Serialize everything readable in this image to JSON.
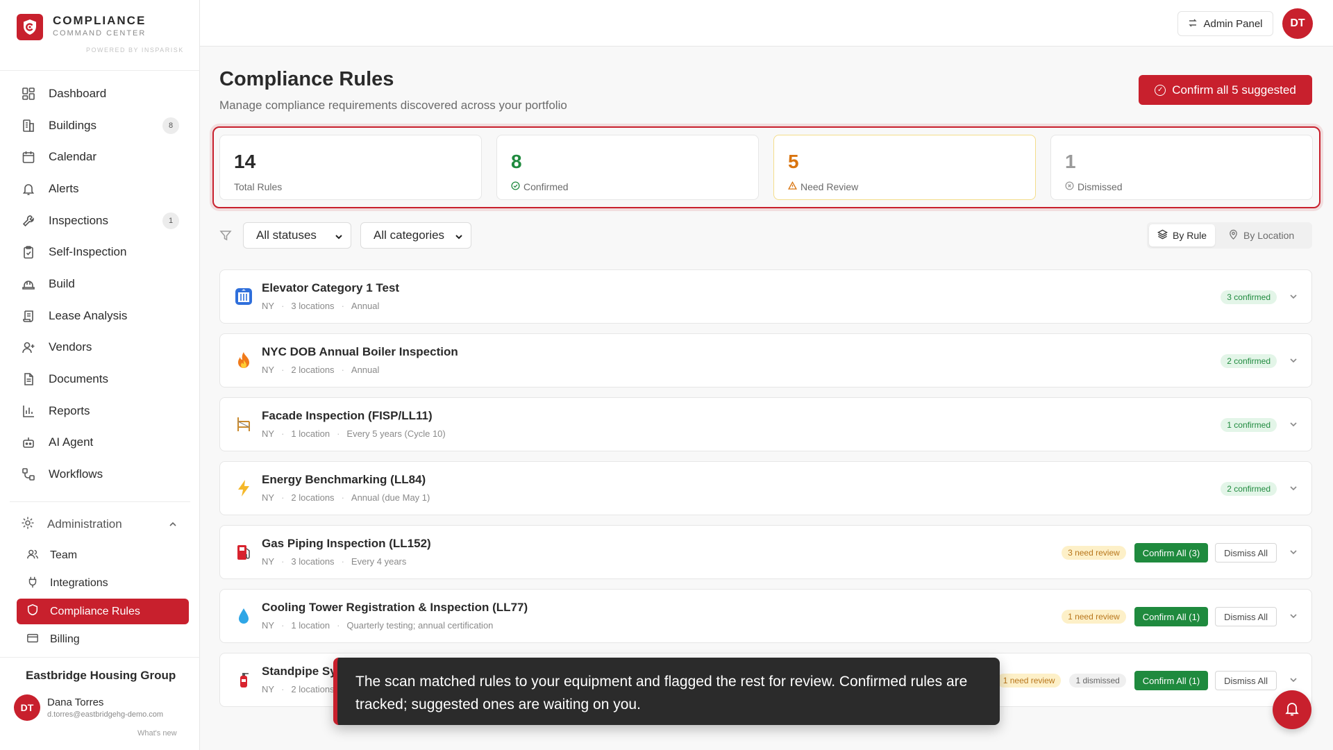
{
  "brand": {
    "title": "COMPLIANCE",
    "subtitle": "COMMAND CENTER",
    "powered": "POWERED BY INSPARISK"
  },
  "nav": {
    "items": [
      {
        "label": "Dashboard",
        "icon": "dashboard-icon",
        "badge": ""
      },
      {
        "label": "Buildings",
        "icon": "building-icon",
        "badge": "8"
      },
      {
        "label": "Calendar",
        "icon": "calendar-icon",
        "badge": ""
      },
      {
        "label": "Alerts",
        "icon": "bell-icon",
        "badge": ""
      },
      {
        "label": "Inspections",
        "icon": "wrench-icon",
        "badge": "1"
      },
      {
        "label": "Self-Inspection",
        "icon": "clipboard-icon",
        "badge": ""
      },
      {
        "label": "Build",
        "icon": "hardhat-icon",
        "badge": ""
      },
      {
        "label": "Lease Analysis",
        "icon": "scroll-icon",
        "badge": ""
      },
      {
        "label": "Vendors",
        "icon": "user-plus-icon",
        "badge": ""
      },
      {
        "label": "Documents",
        "icon": "document-icon",
        "badge": ""
      },
      {
        "label": "Reports",
        "icon": "bar-chart-icon",
        "badge": ""
      },
      {
        "label": "AI Agent",
        "icon": "bot-icon",
        "badge": ""
      },
      {
        "label": "Workflows",
        "icon": "workflow-icon",
        "badge": ""
      }
    ],
    "admin_label": "Administration",
    "sub_items": [
      {
        "label": "Team",
        "icon": "users-icon"
      },
      {
        "label": "Integrations",
        "icon": "plug-icon"
      },
      {
        "label": "Compliance Rules",
        "icon": "shield-icon"
      },
      {
        "label": "Billing",
        "icon": "credit-card-icon"
      }
    ]
  },
  "org": {
    "name": "Eastbridge Housing Group",
    "user_initials": "DT",
    "user_name": "Dana Torres",
    "user_email": "d.torres@eastbridgehg-demo.com",
    "whats_new": "What's new"
  },
  "topbar": {
    "admin_panel": "Admin Panel",
    "avatar_initials": "DT"
  },
  "page": {
    "title": "Compliance Rules",
    "subtitle": "Manage compliance requirements discovered across your portfolio",
    "confirm_all": "Confirm all 5 suggested"
  },
  "stats": [
    {
      "value": "14",
      "label": "Total Rules",
      "color": "#2a2a2a"
    },
    {
      "value": "8",
      "label": "Confirmed",
      "color": "#1f8a3e"
    },
    {
      "value": "5",
      "label": "Need Review",
      "color": "#d9740f"
    },
    {
      "value": "1",
      "label": "Dismissed",
      "color": "#9a9a9a"
    }
  ],
  "filters": {
    "status": "All statuses",
    "category": "All categories",
    "by_rule": "By Rule",
    "by_location": "By Location"
  },
  "rules": [
    {
      "title": "Elevator Category 1 Test",
      "state": "NY",
      "locations": "3 locations",
      "frequency": "Annual",
      "icon": "elevator-icon",
      "confirmed": "3 confirmed",
      "review": "",
      "dismissed": "",
      "confirm_btn": "",
      "dismiss_btn": ""
    },
    {
      "title": "NYC DOB Annual Boiler Inspection",
      "state": "NY",
      "locations": "2 locations",
      "frequency": "Annual",
      "icon": "fire-icon",
      "confirmed": "2 confirmed",
      "review": "",
      "dismissed": "",
      "confirm_btn": "",
      "dismiss_btn": ""
    },
    {
      "title": "Facade Inspection (FISP/LL11)",
      "state": "NY",
      "locations": "1 location",
      "frequency": "Every 5 years (Cycle 10)",
      "icon": "scaffold-icon",
      "confirmed": "1 confirmed",
      "review": "",
      "dismissed": "",
      "confirm_btn": "",
      "dismiss_btn": ""
    },
    {
      "title": "Energy Benchmarking (LL84)",
      "state": "NY",
      "locations": "2 locations",
      "frequency": "Annual (due May 1)",
      "icon": "lightning-icon",
      "confirmed": "2 confirmed",
      "review": "",
      "dismissed": "",
      "confirm_btn": "",
      "dismiss_btn": ""
    },
    {
      "title": "Gas Piping Inspection (LL152)",
      "state": "NY",
      "locations": "3 locations",
      "frequency": "Every 4 years",
      "icon": "fuel-pump-icon",
      "confirmed": "",
      "review": "3 need review",
      "dismissed": "",
      "confirm_btn": "Confirm All (3)",
      "dismiss_btn": "Dismiss All"
    },
    {
      "title": "Cooling Tower Registration & Inspection (LL77)",
      "state": "NY",
      "locations": "1 location",
      "frequency": "Quarterly testing; annual certification",
      "icon": "droplet-icon",
      "confirmed": "",
      "review": "1 need review",
      "dismissed": "",
      "confirm_btn": "Confirm All (1)",
      "dismiss_btn": "Dismiss All"
    },
    {
      "title": "Standpipe System Inspection",
      "state": "NY",
      "locations": "2 locations",
      "frequency": "",
      "icon": "fire-extinguisher-icon",
      "confirmed": "",
      "review": "1 need review",
      "dismissed": "1 dismissed",
      "confirm_btn": "Confirm All (1)",
      "dismiss_btn": "Dismiss All"
    }
  ],
  "toast": {
    "text": "The scan matched rules to your equipment and flagged the rest for review. Confirmed rules are tracked; suggested ones are waiting on you."
  },
  "colors": {
    "brand": "#c8202d",
    "green": "#1f8a3e",
    "review": "#d9740f"
  }
}
